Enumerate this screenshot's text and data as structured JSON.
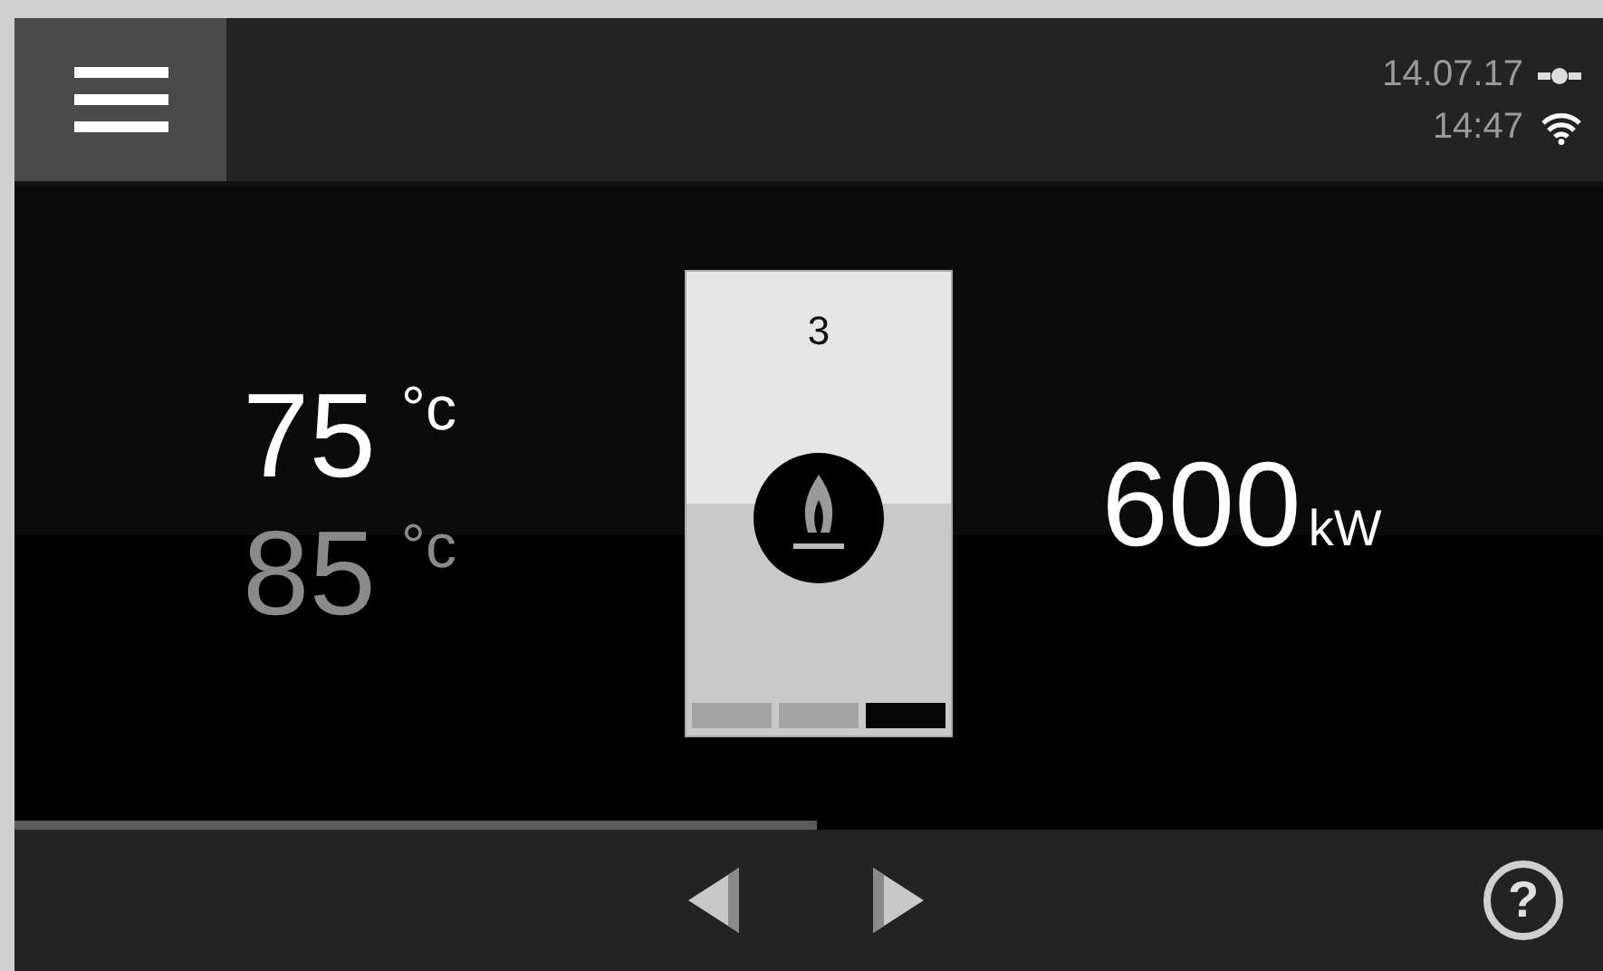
{
  "header": {
    "date": "14.07.17",
    "time": "14:47"
  },
  "temperatures": [
    {
      "value": "75",
      "unit": "°c",
      "kind": "actual"
    },
    {
      "value": "85",
      "unit": "°c",
      "kind": "setpoint"
    }
  ],
  "boiler": {
    "number": "3",
    "segments": [
      {
        "selected": false
      },
      {
        "selected": false
      },
      {
        "selected": true
      }
    ]
  },
  "power": {
    "value": "600",
    "unit": "kW"
  },
  "progress": {
    "level": 0.505
  },
  "footer": {
    "help": "?"
  }
}
